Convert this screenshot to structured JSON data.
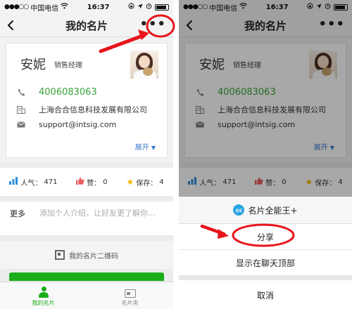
{
  "status": {
    "carrier": "中国电信",
    "time": "16:37"
  },
  "nav": {
    "title": "我的名片"
  },
  "card": {
    "name": "安妮",
    "job_title": "销售经理",
    "phone": "4006083063",
    "company": "上海合合信息科技发展有限公司",
    "email": "support@intsig.com",
    "expand_label": "展开"
  },
  "stats": {
    "popularity_label": "人气：",
    "popularity_value": "471",
    "likes_label": "赞：",
    "likes_value": "0",
    "saves_label": "保存：",
    "saves_value": "4"
  },
  "intro": {
    "label": "更多",
    "placeholder": "添加个人介绍，让好友更了解你…"
  },
  "qr": {
    "label": "我的名片二维码"
  },
  "tabs": [
    {
      "label": "我的名片"
    },
    {
      "label": "名片夹"
    }
  ],
  "share_sheet": {
    "app_icon_text": "cc",
    "app_name": "名片全能王+",
    "share_label": "分享",
    "pin_label": "显示在聊天顶部",
    "cancel_label": "取消"
  },
  "colors": {
    "accent_green": "#1aad19",
    "phone_green": "#35a43a",
    "link_blue": "#3a7ad1",
    "annotation_red": "#e8141b"
  }
}
